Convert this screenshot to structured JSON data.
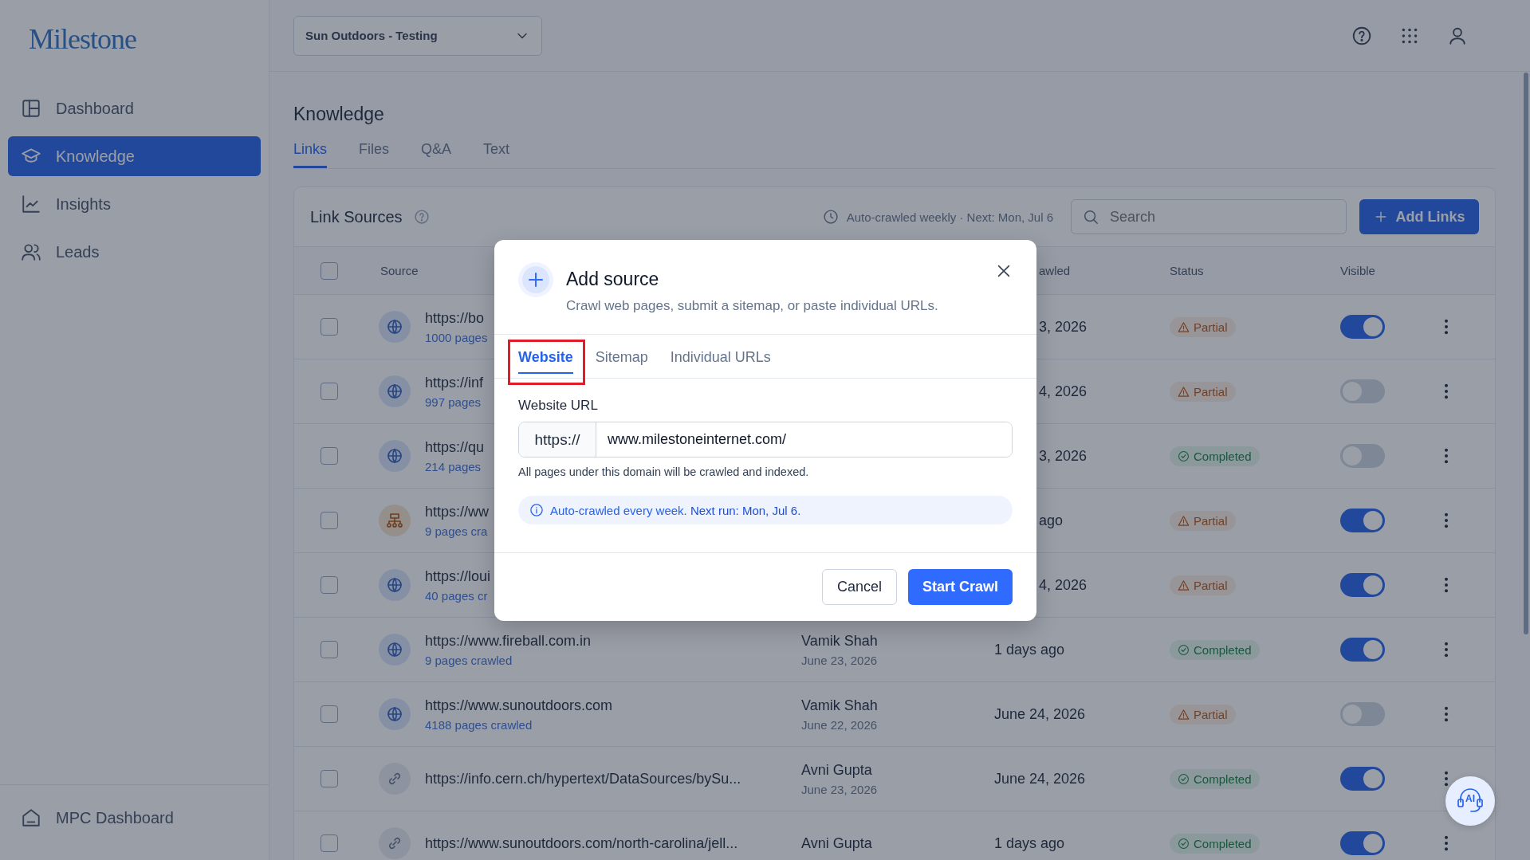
{
  "sidebar": {
    "logo": "Milestone",
    "items": [
      {
        "label": "Dashboard",
        "selected": false
      },
      {
        "label": "Knowledge",
        "selected": true
      },
      {
        "label": "Insights",
        "selected": false
      },
      {
        "label": "Leads",
        "selected": false
      }
    ],
    "footer_item": {
      "label": "MPC Dashboard"
    }
  },
  "topbar": {
    "workspace": "Sun Outdoors - Testing"
  },
  "page": {
    "title": "Knowledge",
    "tabs": [
      {
        "label": "Links",
        "selected": true
      },
      {
        "label": "Files",
        "selected": false
      },
      {
        "label": "Q&A",
        "selected": false
      },
      {
        "label": "Text",
        "selected": false
      }
    ]
  },
  "card": {
    "title": "Link Sources",
    "schedule": "Auto-crawled weekly · Next: Mon, Jul 6",
    "search": {
      "placeholder": "Search"
    },
    "add_button": "Add Links",
    "header": {
      "checked": false,
      "source": "Source",
      "column_4": "awled",
      "status": "Status",
      "visible": "Visible"
    },
    "rows": [
      {
        "checked": false,
        "kind": "website",
        "url": "https://bo",
        "pages": "1000 pages",
        "crawled": "3, 2026",
        "status": {
          "kind": "partial",
          "label": "Partial"
        },
        "visible": true
      },
      {
        "checked": false,
        "kind": "website",
        "url": "https://inf",
        "pages": "997 pages",
        "crawled": "4, 2026",
        "status": {
          "kind": "partial",
          "label": "Partial"
        },
        "visible": false
      },
      {
        "checked": false,
        "kind": "website",
        "url": "https://qu",
        "pages": "214 pages",
        "crawled": "3, 2026",
        "status": {
          "kind": "completed",
          "label": "Completed"
        },
        "visible": false
      },
      {
        "checked": false,
        "kind": "sitemap",
        "url": "https://ww",
        "pages": "9 pages cra",
        "crawled": "ago",
        "status": {
          "kind": "partial",
          "label": "Partial"
        },
        "visible": true
      },
      {
        "checked": false,
        "kind": "website",
        "url": "https://loui",
        "pages": "40 pages cr",
        "crawled": "4, 2026",
        "status": {
          "kind": "partial",
          "label": "Partial"
        },
        "visible": true
      },
      {
        "checked": false,
        "kind": "website",
        "url": "https://www.fireball.com.in",
        "pages": "9 pages crawled",
        "added_by": "Vamik Shah",
        "added_on": "June 23, 2026",
        "crawled": "1 days ago",
        "status": {
          "kind": "completed",
          "label": "Completed"
        },
        "visible": true
      },
      {
        "checked": false,
        "kind": "website",
        "url": "https://www.sunoutdoors.com",
        "pages": "4188 pages crawled",
        "added_by": "Vamik Shah",
        "added_on": "June 22, 2026",
        "crawled": "June 24, 2026",
        "status": {
          "kind": "partial",
          "label": "Partial"
        },
        "visible": false
      },
      {
        "checked": false,
        "kind": "url",
        "url": "https://info.cern.ch/hypertext/DataSources/bySu...",
        "added_by": "Avni Gupta",
        "added_on": "June 23, 2026",
        "crawled": "June 24, 2026",
        "status": {
          "kind": "completed",
          "label": "Completed"
        },
        "visible": true
      },
      {
        "checked": false,
        "kind": "url",
        "url": "https://www.sunoutdoors.com/north-carolina/jell...",
        "added_by": "Avni Gupta",
        "crawled": "1 days ago",
        "status": {
          "kind": "completed",
          "label": "Completed"
        },
        "visible": true
      }
    ]
  },
  "assistant_button": {
    "label": "AI"
  },
  "modal": {
    "title": "Add source",
    "subtitle": "Crawl web pages, submit a sitemap, or paste individual URLs.",
    "tabs": [
      {
        "label": "Website",
        "selected": true,
        "highlighted": true
      },
      {
        "label": "Sitemap",
        "selected": false,
        "highlighted": false
      },
      {
        "label": "Individual URLs",
        "selected": false,
        "highlighted": false
      }
    ],
    "field": {
      "label": "Website URL",
      "prefix": "https://",
      "value": "www.milestoneinternet.com/",
      "hint": "All pages under this domain will be crawled and indexed."
    },
    "notice": "Auto-crawled every week. **Next run: Mon, Jul 6.**",
    "buttons": {
      "cancel": "Cancel",
      "confirm": "Start Crawl"
    }
  }
}
